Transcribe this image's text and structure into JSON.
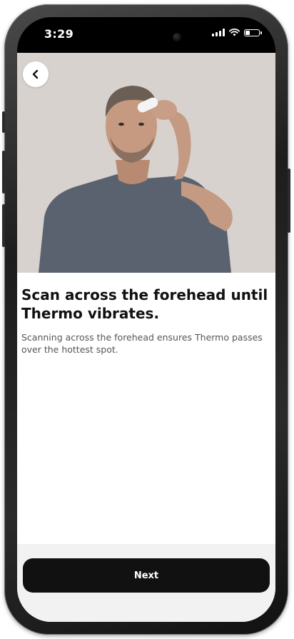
{
  "status_bar": {
    "time": "3:29"
  },
  "navigation": {
    "back_icon": "chevron-left-icon"
  },
  "hero": {
    "image_description_icon": "person-scanning-forehead-photo"
  },
  "instruction": {
    "title": "Scan across the forehead until Thermo vibrates.",
    "description": "Scanning across the forehead ensures Thermo passes over the hottest spot."
  },
  "footer": {
    "next_label": "Next"
  },
  "colors": {
    "button_bg": "#111111",
    "button_text": "#ffffff",
    "title_text": "#111111",
    "body_text": "#555555",
    "hero_bg": "#d6d1cd"
  }
}
